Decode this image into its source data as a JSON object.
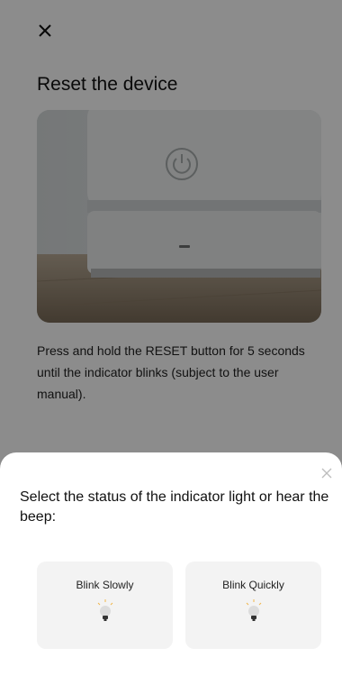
{
  "header": {
    "close_icon": "close-icon"
  },
  "main": {
    "title": "Reset the device",
    "image_icon": "device-image",
    "instructions": "Press and hold the RESET button for 5 seconds until the indicator blinks (subject to the user manual)."
  },
  "sheet": {
    "close_icon": "close-icon",
    "title": "Select the status of the indicator light or hear the beep:",
    "options": [
      {
        "label": "Blink Slowly",
        "icon": "bulb-icon"
      },
      {
        "label": "Blink Quickly",
        "icon": "bulb-icon"
      }
    ]
  },
  "colors": {
    "overlay": "#737373",
    "sheet_bg": "#ffffff",
    "card_bg": "#f3f3f3"
  }
}
